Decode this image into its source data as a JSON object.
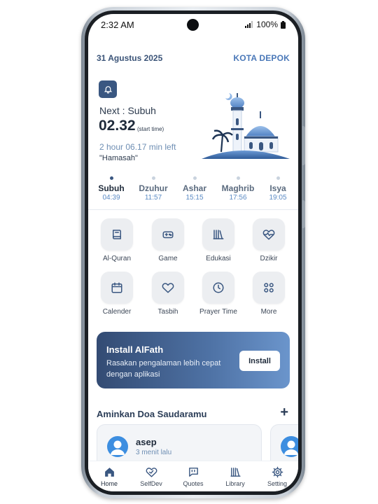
{
  "status_bar": {
    "time": "2:32 AM",
    "battery": "100%"
  },
  "header": {
    "date": "31 Agustus 2025",
    "city": "KOTA DEPOK"
  },
  "hero": {
    "next_label": "Next : Subuh",
    "next_time": "02.32",
    "next_time_note": "(start time)",
    "time_left": "2 hour 06.17 min left",
    "phase_name": "\"Hamasah\""
  },
  "prayers": [
    {
      "name": "Subuh",
      "time": "04:39",
      "active": true
    },
    {
      "name": "Dzuhur",
      "time": "11:57",
      "active": false
    },
    {
      "name": "Ashar",
      "time": "15:15",
      "active": false
    },
    {
      "name": "Maghrib",
      "time": "17:56",
      "active": false
    },
    {
      "name": "Isya",
      "time": "19:05",
      "active": false
    }
  ],
  "menu": [
    {
      "label": "Al-Quran",
      "icon": "book-icon"
    },
    {
      "label": "Game",
      "icon": "gamepad-icon"
    },
    {
      "label": "Edukasi",
      "icon": "library-icon"
    },
    {
      "label": "Dzikir",
      "icon": "heart-pulse-icon"
    },
    {
      "label": "Calender",
      "icon": "calendar-icon"
    },
    {
      "label": "Tasbih",
      "icon": "heart-icon"
    },
    {
      "label": "Prayer Time",
      "icon": "clock-icon"
    },
    {
      "label": "More",
      "icon": "grid-icon"
    }
  ],
  "banner": {
    "title": "Install AlFath",
    "subtitle": "Rasakan pengalaman lebih cepat dengan aplikasi",
    "button": "Install"
  },
  "doa": {
    "title": "Aminkan Doa Saudaramu",
    "add": "+",
    "cards": [
      {
        "name": "asep",
        "time": "3 menit lalu"
      }
    ]
  },
  "nav": [
    {
      "label": "Home",
      "icon": "home-icon",
      "active": true
    },
    {
      "label": "SelfDev",
      "icon": "selfdev-icon",
      "active": false
    },
    {
      "label": "Quotes",
      "icon": "quotes-icon",
      "active": false
    },
    {
      "label": "Library",
      "icon": "library-icon",
      "active": false
    },
    {
      "label": "Setting",
      "icon": "settings-icon",
      "active": false
    }
  ],
  "colors": {
    "primary": "#3a5781",
    "accent": "#4a78b8",
    "time_blue": "#5a8ac4"
  }
}
